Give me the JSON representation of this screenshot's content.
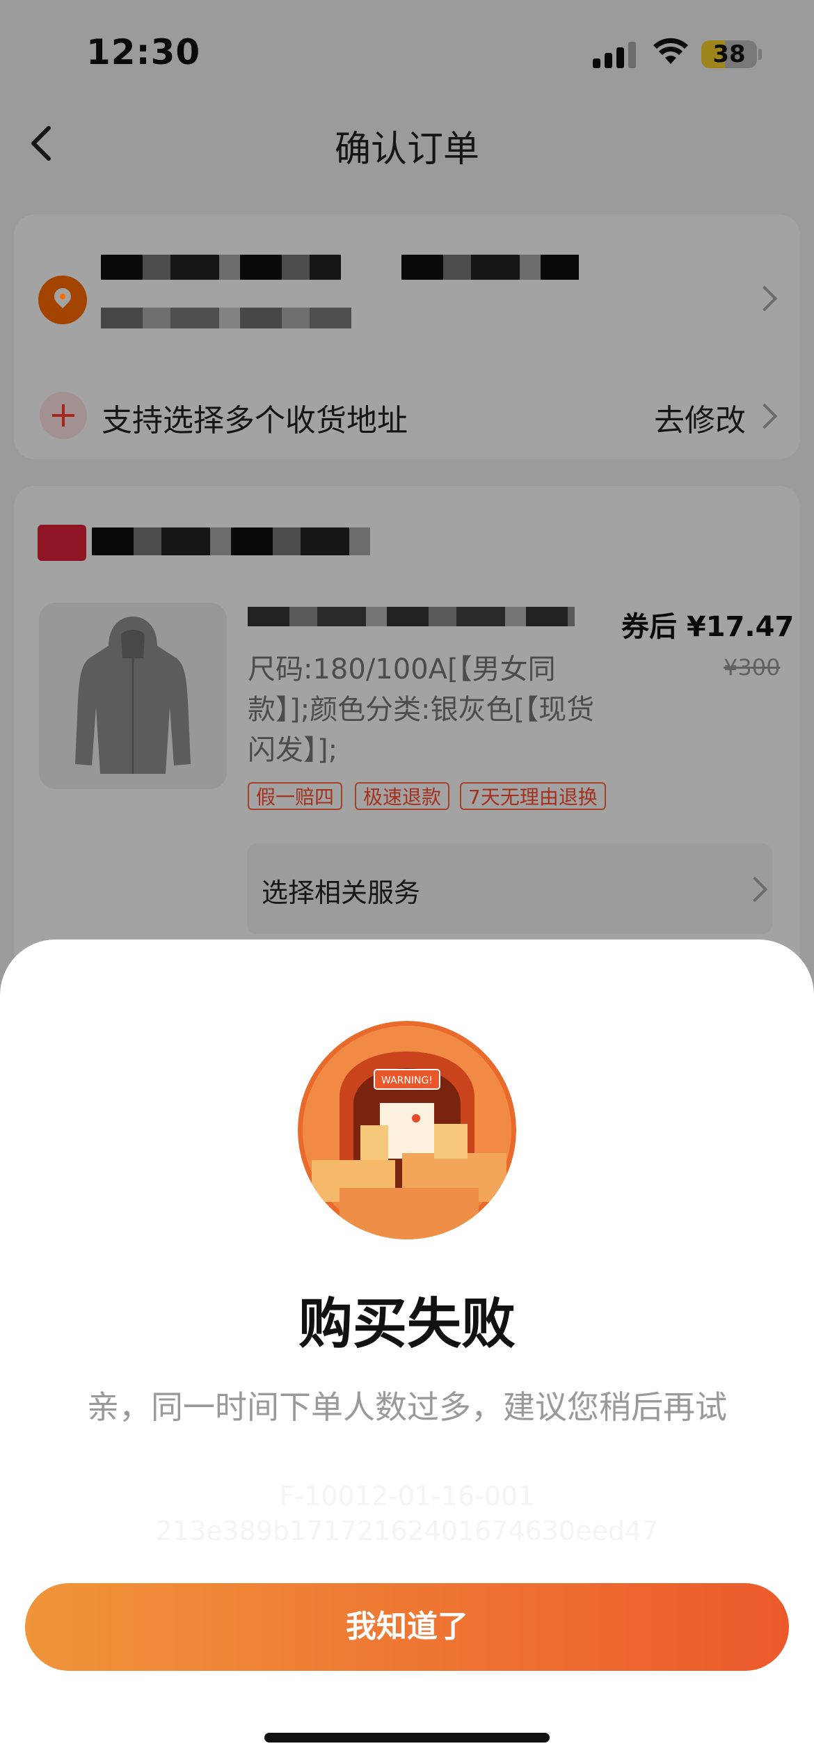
{
  "status_bar": {
    "time": "12:30",
    "battery": "38"
  },
  "nav": {
    "title": "确认订单"
  },
  "address": {
    "multi_label": "支持选择多个收货地址",
    "modify_label": "去修改"
  },
  "order": {
    "price_after_coupon": "券后 ¥17.47",
    "original_price": "¥300",
    "spec": "尺码:180/100A[【男女同款】];颜色分类:银灰色[【现货闪发】];",
    "tags": [
      "假一赔四",
      "极速退款",
      "7天无理由退换"
    ],
    "service_label": "选择相关服务"
  },
  "dialog": {
    "illustration_sign": "WARNING!",
    "title": "购买失败",
    "message": "亲，同一时间下单人数过多，建议您稍后再试",
    "code_line1": "F-10012-01-16-001",
    "code_line2": "213e389b17172162401674630eed47",
    "confirm_label": "我知道了"
  },
  "colors": {
    "accent": "#ff6a00",
    "button_start": "#f0953a",
    "button_end": "#ec5a2c"
  }
}
